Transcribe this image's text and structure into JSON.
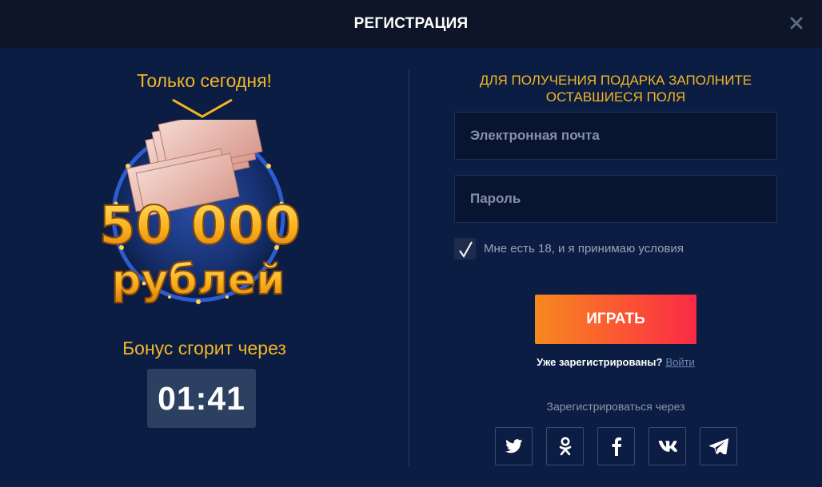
{
  "header": {
    "title": "РЕГИСТРАЦИЯ"
  },
  "promo": {
    "headline": "Только сегодня!",
    "prize_amount": "50 000",
    "prize_currency": "рублей",
    "bonus_text": "Бонус сгорит через",
    "timer": "01:41"
  },
  "form": {
    "heading_line1": "ДЛЯ ПОЛУЧЕНИЯ ПОДАРКА ЗАПОЛНИТЕ",
    "heading_line2": "ОСТАВШИЕСЯ ПОЛЯ",
    "email_placeholder": "Электронная почта",
    "email_value": "",
    "password_placeholder": "Пароль",
    "password_value": "",
    "terms_checked": true,
    "terms_label": "Мне есть 18, и я принимаю условия",
    "submit_label": "ИГРАТЬ",
    "already_registered": "Уже зарегистрированы?",
    "login_link": "Войти"
  },
  "social": {
    "heading": "Зарегистрироваться через",
    "buttons": [
      "twitter-icon",
      "odnoklassniki-icon",
      "facebook-icon",
      "vk-icon",
      "telegram-icon"
    ]
  },
  "colors": {
    "background": "#0b1d43",
    "header": "#0d1628",
    "accent_gold": "#f4b524",
    "button_start": "#f7891e",
    "button_end": "#fb2a45"
  }
}
